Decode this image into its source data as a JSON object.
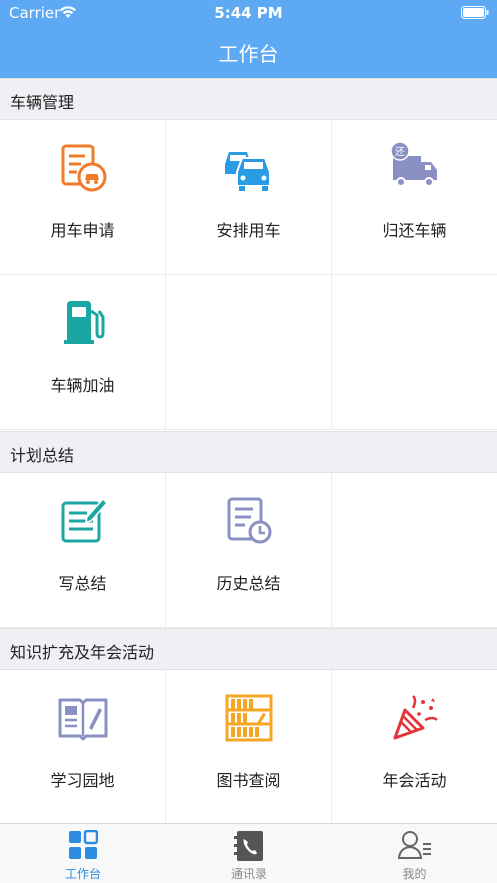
{
  "status_bar": {
    "carrier": "Carrier",
    "time": "5:44 PM"
  },
  "nav": {
    "title": "工作台"
  },
  "sections": [
    {
      "title": "车辆管理",
      "items": [
        {
          "label": "用车申请",
          "icon": "car-application-icon",
          "color": "#f07b2b"
        },
        {
          "label": "安排用车",
          "icon": "cars-icon",
          "color": "#2a9be5"
        },
        {
          "label": "归还车辆",
          "icon": "return-truck-icon",
          "color": "#8a8fc4"
        },
        {
          "label": "车辆加油",
          "icon": "fuel-pump-icon",
          "color": "#1aa7a3"
        }
      ]
    },
    {
      "title": "计划总结",
      "items": [
        {
          "label": "写总结",
          "icon": "write-summary-icon",
          "color": "#1aa7a3"
        },
        {
          "label": "历史总结",
          "icon": "history-summary-icon",
          "color": "#8a8fc4"
        }
      ]
    },
    {
      "title": "知识扩充及年会活动",
      "items": [
        {
          "label": "学习园地",
          "icon": "open-book-icon",
          "color": "#8a8fc4"
        },
        {
          "label": "图书查阅",
          "icon": "bookshelf-icon",
          "color": "#f5a623"
        },
        {
          "label": "年会活动",
          "icon": "party-popper-icon",
          "color": "#e5333a"
        }
      ]
    }
  ],
  "tabbar": {
    "tabs": [
      {
        "label": "工作台",
        "icon": "dashboard-grid-icon",
        "active": true
      },
      {
        "label": "通讯录",
        "icon": "contacts-phone-icon",
        "active": false
      },
      {
        "label": "我的",
        "icon": "user-profile-icon",
        "active": false
      }
    ],
    "active_color": "#2b8ce0"
  }
}
